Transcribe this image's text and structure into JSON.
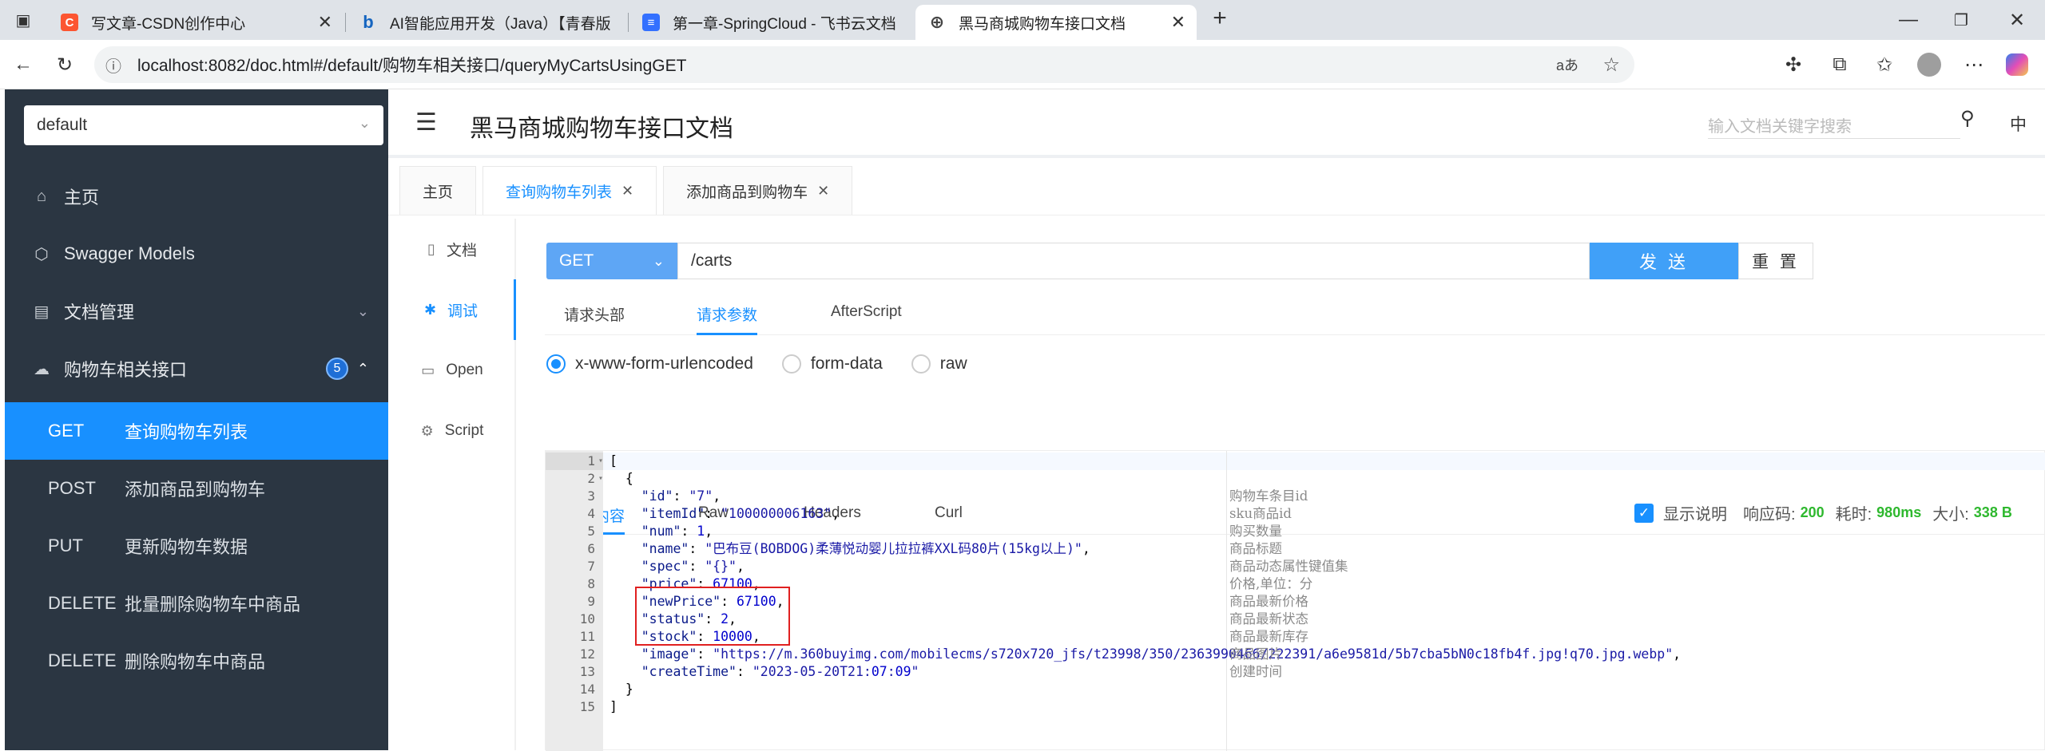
{
  "browser": {
    "tabs": [
      {
        "title": "写文章-CSDN创作中心",
        "icon_color": "#fc5531",
        "icon_letter": "C"
      },
      {
        "title": "AI智能应用开发（Java）【青春版",
        "icon_color": "#1565c0",
        "icon_letter": "b"
      },
      {
        "title": "第一章-SpringCloud - 飞书云文档",
        "icon_color": "#3370ff",
        "icon_letter": "≡"
      },
      {
        "title": "黑马商城购物车接口文档",
        "icon_color": "#555555",
        "icon_letter": "⊕"
      }
    ],
    "url": "localhost:8082/doc.html#/default/购物车相关接口/queryMyCartsUsingGET"
  },
  "sidebar": {
    "group_select": "default",
    "items": [
      {
        "label": "主页",
        "icon": "home-icon"
      },
      {
        "label": "Swagger Models",
        "icon": "cube-icon"
      },
      {
        "label": "文档管理",
        "icon": "folder-icon"
      },
      {
        "label": "购物车相关接口",
        "icon": "cloud-icon",
        "badge": "5"
      }
    ],
    "endpoints": [
      {
        "method": "GET",
        "label": "查询购物车列表",
        "active": true
      },
      {
        "method": "POST",
        "label": "添加商品到购物车"
      },
      {
        "method": "PUT",
        "label": "更新购物车数据"
      },
      {
        "method": "DELETE",
        "label": "批量删除购物车中商品"
      },
      {
        "method": "DELETE",
        "label": "删除购物车中商品"
      }
    ]
  },
  "header": {
    "title": "黑马商城购物车接口文档",
    "search_placeholder": "输入文档关键字搜索",
    "lang": "中"
  },
  "page_tabs": [
    {
      "label": "主页"
    },
    {
      "label": "查询购物车列表",
      "active": true
    },
    {
      "label": "添加商品到购物车"
    }
  ],
  "left_nav": [
    {
      "label": "文档",
      "icon": "document-icon"
    },
    {
      "label": "调试",
      "icon": "bug-icon",
      "active": true
    },
    {
      "label": "Open",
      "icon": "file-icon"
    },
    {
      "label": "Script",
      "icon": "gear-icon"
    }
  ],
  "request": {
    "method": "GET",
    "path": "/carts",
    "send_label": "发 送",
    "reset_label": "重 置",
    "tabs": [
      "请求头部",
      "请求参数",
      "AfterScript"
    ],
    "active_tab": "请求参数",
    "content_types": [
      "x-www-form-urlencoded",
      "form-data",
      "raw"
    ],
    "selected_content_type": "x-www-form-urlencoded"
  },
  "response": {
    "tabs": [
      "响应内容",
      "Raw",
      "Headers",
      "Curl"
    ],
    "active_tab": "响应内容",
    "show_desc_label": "显示说明",
    "code_label": "响应码:",
    "code_value": "200",
    "time_label": "耗时:",
    "time_value": "980ms",
    "size_label": "大小:",
    "size_value": "338 B",
    "line_numbers": [
      "1",
      "2",
      "3",
      "4",
      "5",
      "6",
      "7",
      "8",
      "9",
      "10",
      "11",
      "12",
      "13",
      "14",
      "15"
    ],
    "lines": [
      "[",
      "  {",
      "    \"id\": \"7\",",
      "    \"itemId\": \"100000006163\",",
      "    \"num\": 1,",
      "    \"name\": \"巴布豆(BOBDOG)柔薄悦动婴儿拉拉裤XXL码80片(15kg以上)\",",
      "    \"spec\": \"{}\",",
      "    \"price\": 67100,",
      "    \"newPrice\": 67100,",
      "    \"status\": 2,",
      "    \"stock\": 10000,",
      "    \"image\": \"https://m.360buyimg.com/mobilecms/s720x720_jfs/t23998/350/2363990466/222391/a6e9581d/5b7cba5bN0c18fb4f.jpg!q70.jpg.webp\",",
      "    \"createTime\": \"2023-05-20T21:07:09\"",
      "  }",
      "]"
    ],
    "comments": [
      "",
      "",
      "购物车条目id",
      "sku商品id",
      "购买数量",
      "商品标题",
      "商品动态属性键值集",
      "价格,单位：分",
      "商品最新价格",
      "商品最新状态",
      "商品最新库存",
      "商品图片",
      "创建时间",
      "",
      ""
    ]
  }
}
